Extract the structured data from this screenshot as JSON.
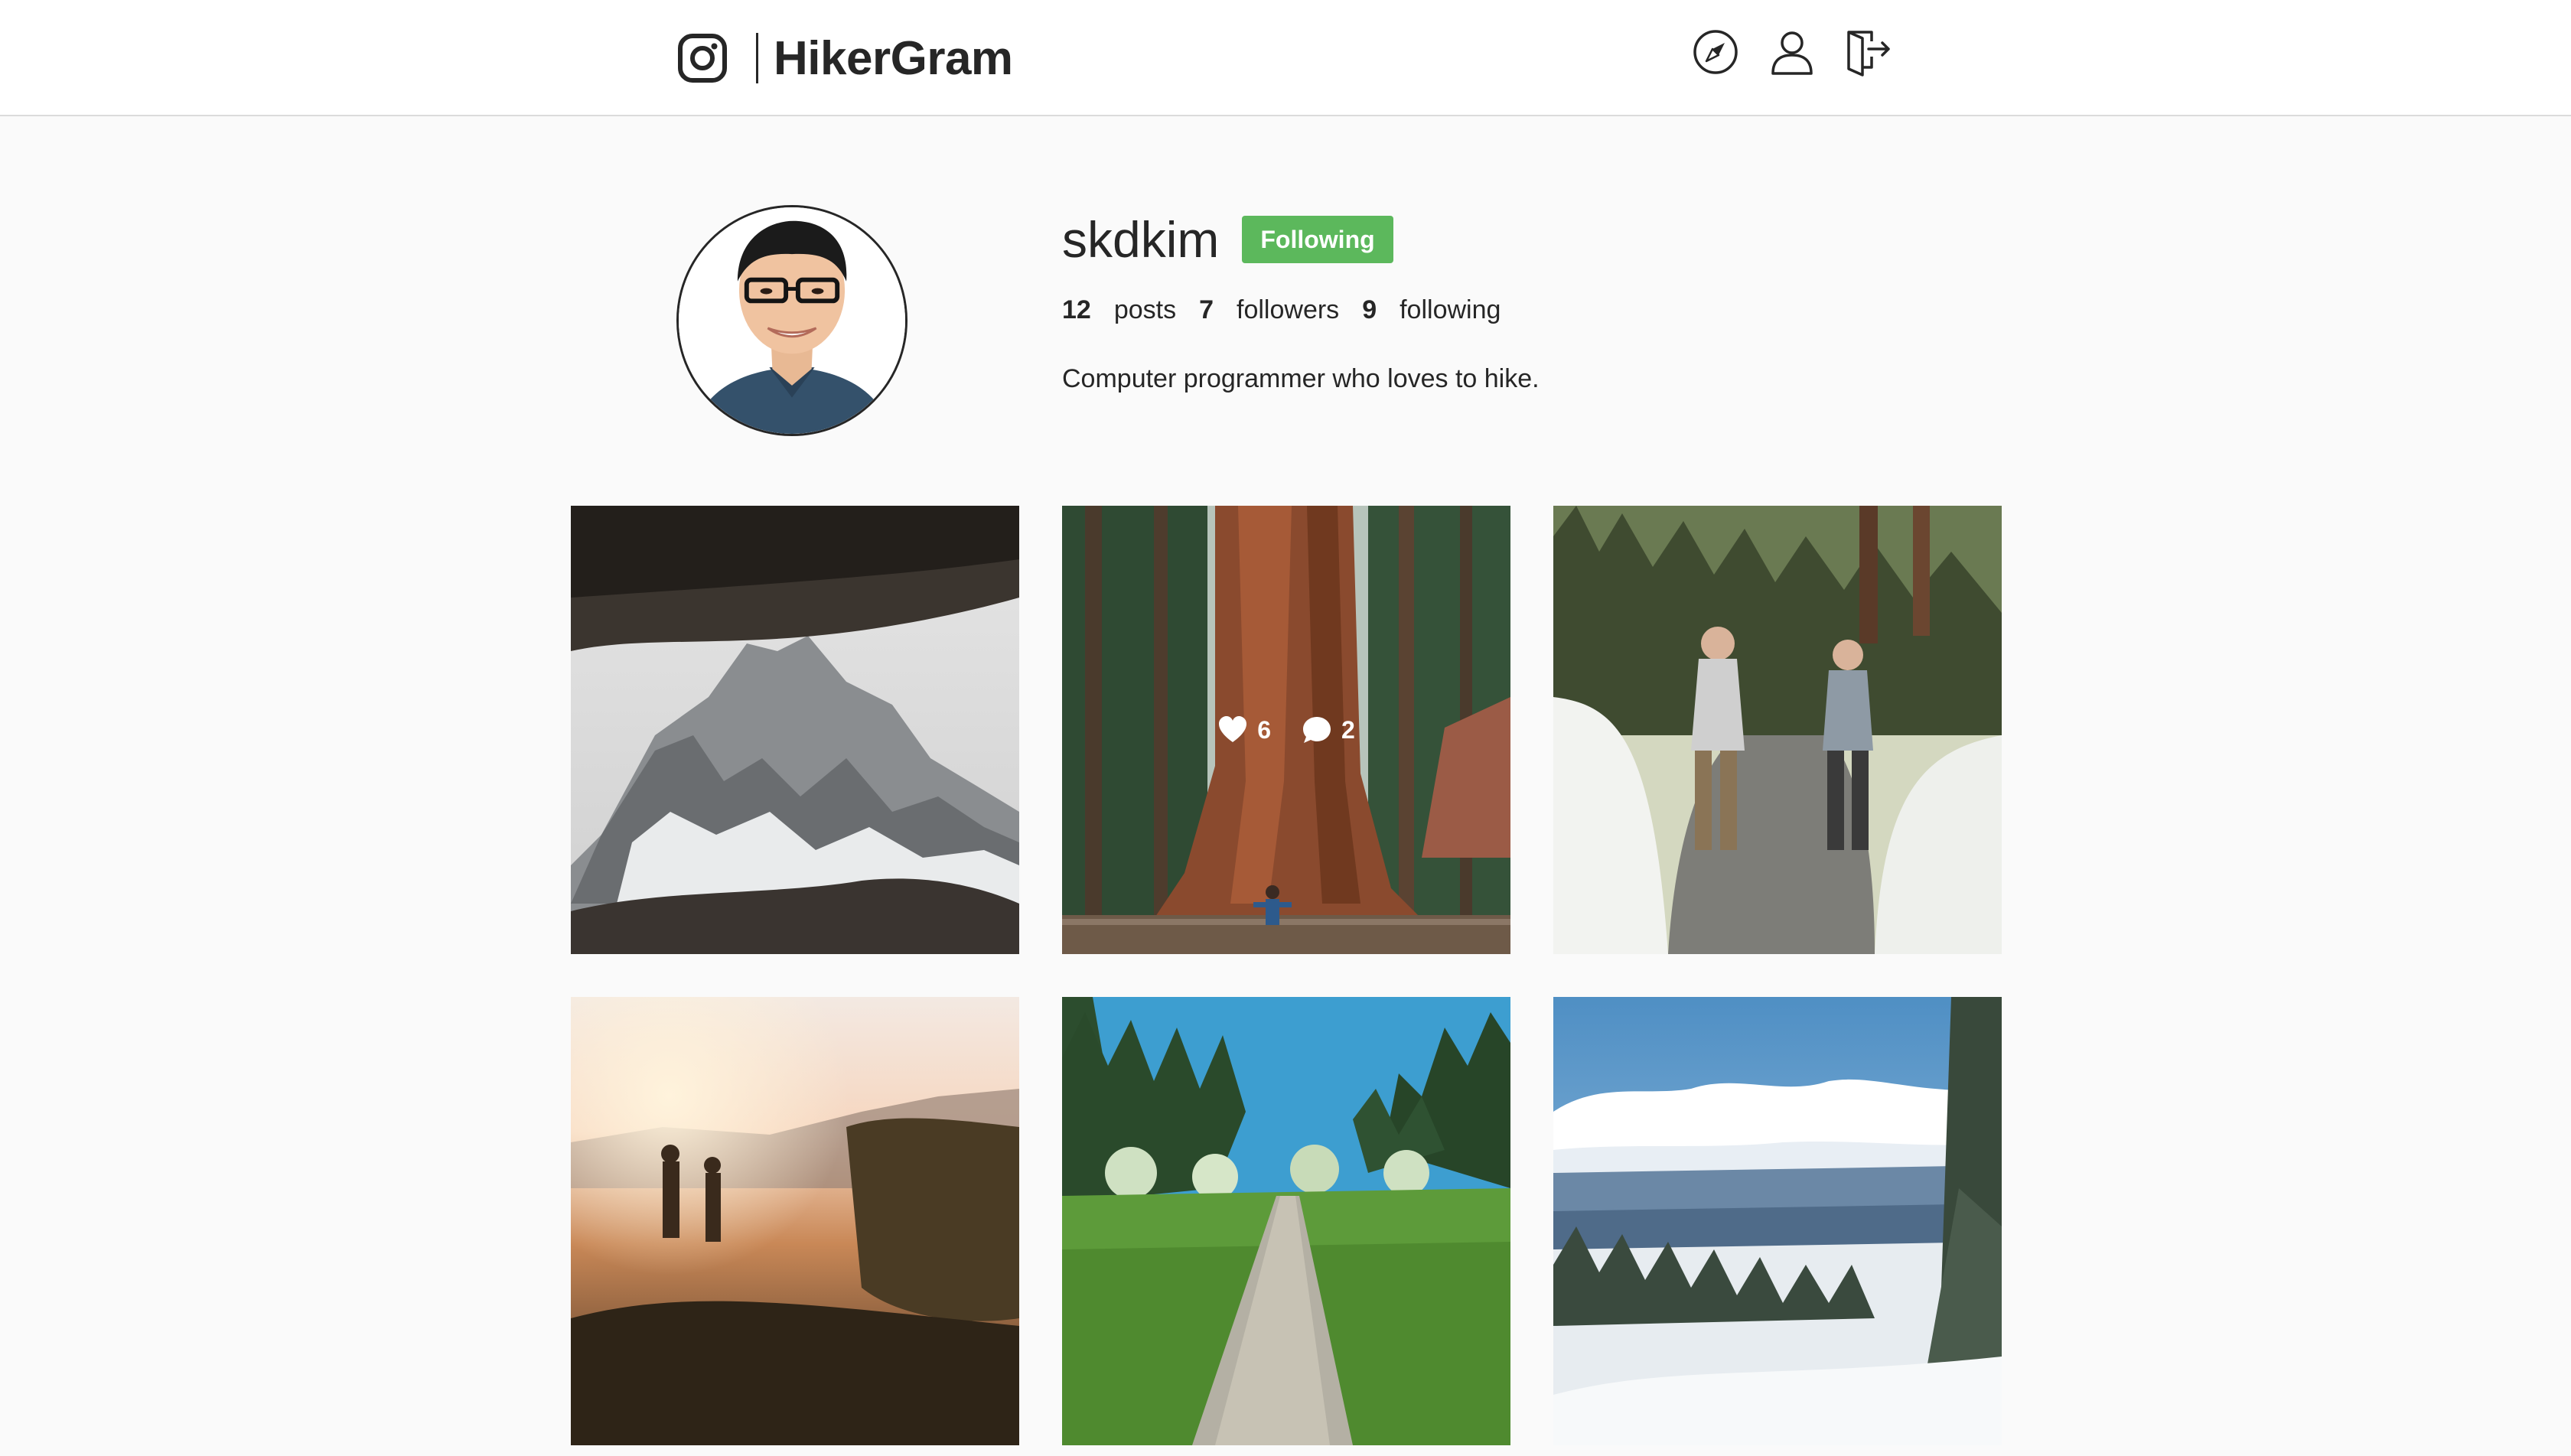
{
  "app": {
    "name": "HikerGram"
  },
  "nav": {
    "icons": [
      "compass-icon",
      "user-icon",
      "logout-icon"
    ]
  },
  "profile": {
    "username": "skdkim",
    "follow_label": "Following",
    "follow_color": "#5cb85c",
    "posts_count": "12",
    "posts_label": "posts",
    "followers_count": "7",
    "followers_label": "followers",
    "following_count": "9",
    "following_label": "following",
    "bio": "Computer programmer who loves to hike."
  },
  "posts": [
    {
      "subject": "cave view of snowy mountain"
    },
    {
      "subject": "giant sequoia tree",
      "likes": "6",
      "comments": "2"
    },
    {
      "subject": "two hikers on snowy trail"
    },
    {
      "subject": "sunset hikers in meadow"
    },
    {
      "subject": "gravel path through trees"
    },
    {
      "subject": "snowy forest with clouds"
    }
  ]
}
